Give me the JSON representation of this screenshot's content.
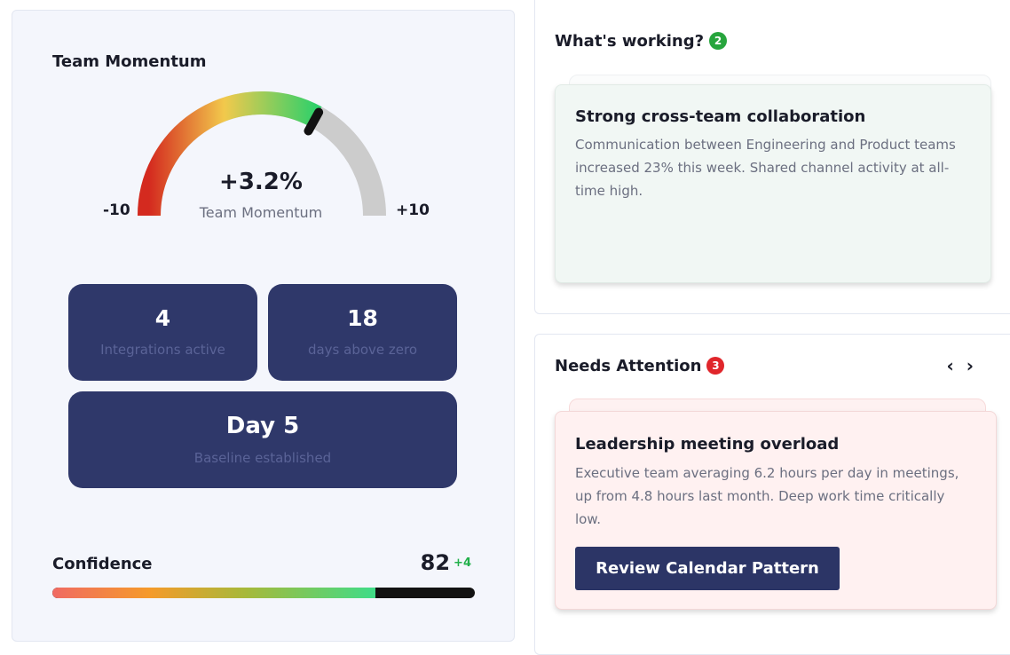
{
  "momentum": {
    "title": "Team Momentum",
    "value": "+3.2%",
    "caption": "Team Momentum",
    "min": "-10",
    "max": "+10",
    "level": 0.66
  },
  "stats": [
    {
      "value": "4",
      "label": "Integrations active"
    },
    {
      "value": "18",
      "label": "days above zero"
    },
    {
      "value": "Day 5",
      "label": "Baseline established"
    }
  ],
  "confidence": {
    "label": "Confidence",
    "value": "82",
    "delta": "+4",
    "percent": 0.765
  },
  "working": {
    "title": "What's working?",
    "count": "2",
    "card_title": "Strong cross-team collaboration",
    "card_text": "Communication between Engineering and Product teams increased 23% this week. Shared channel activity at all-time high."
  },
  "attention": {
    "title": "Needs Attention",
    "count": "3",
    "prev_icon": "‹",
    "next_icon": "›",
    "card_title": "Leadership meeting overload",
    "card_text": "Executive team averaging 6.2 hours per day in meetings, up from 4.8 hours last month. Deep work time critically low.",
    "button_label": "Review Calendar Pattern"
  },
  "colors": {
    "accent_navy": "#2f386a",
    "success": "#27a53d",
    "danger": "#e0262b",
    "gauge_red": "#d42a1f",
    "gauge_yellow": "#f2c94c",
    "gauge_green": "#2fd06a",
    "gauge_track": "#cccccc"
  }
}
